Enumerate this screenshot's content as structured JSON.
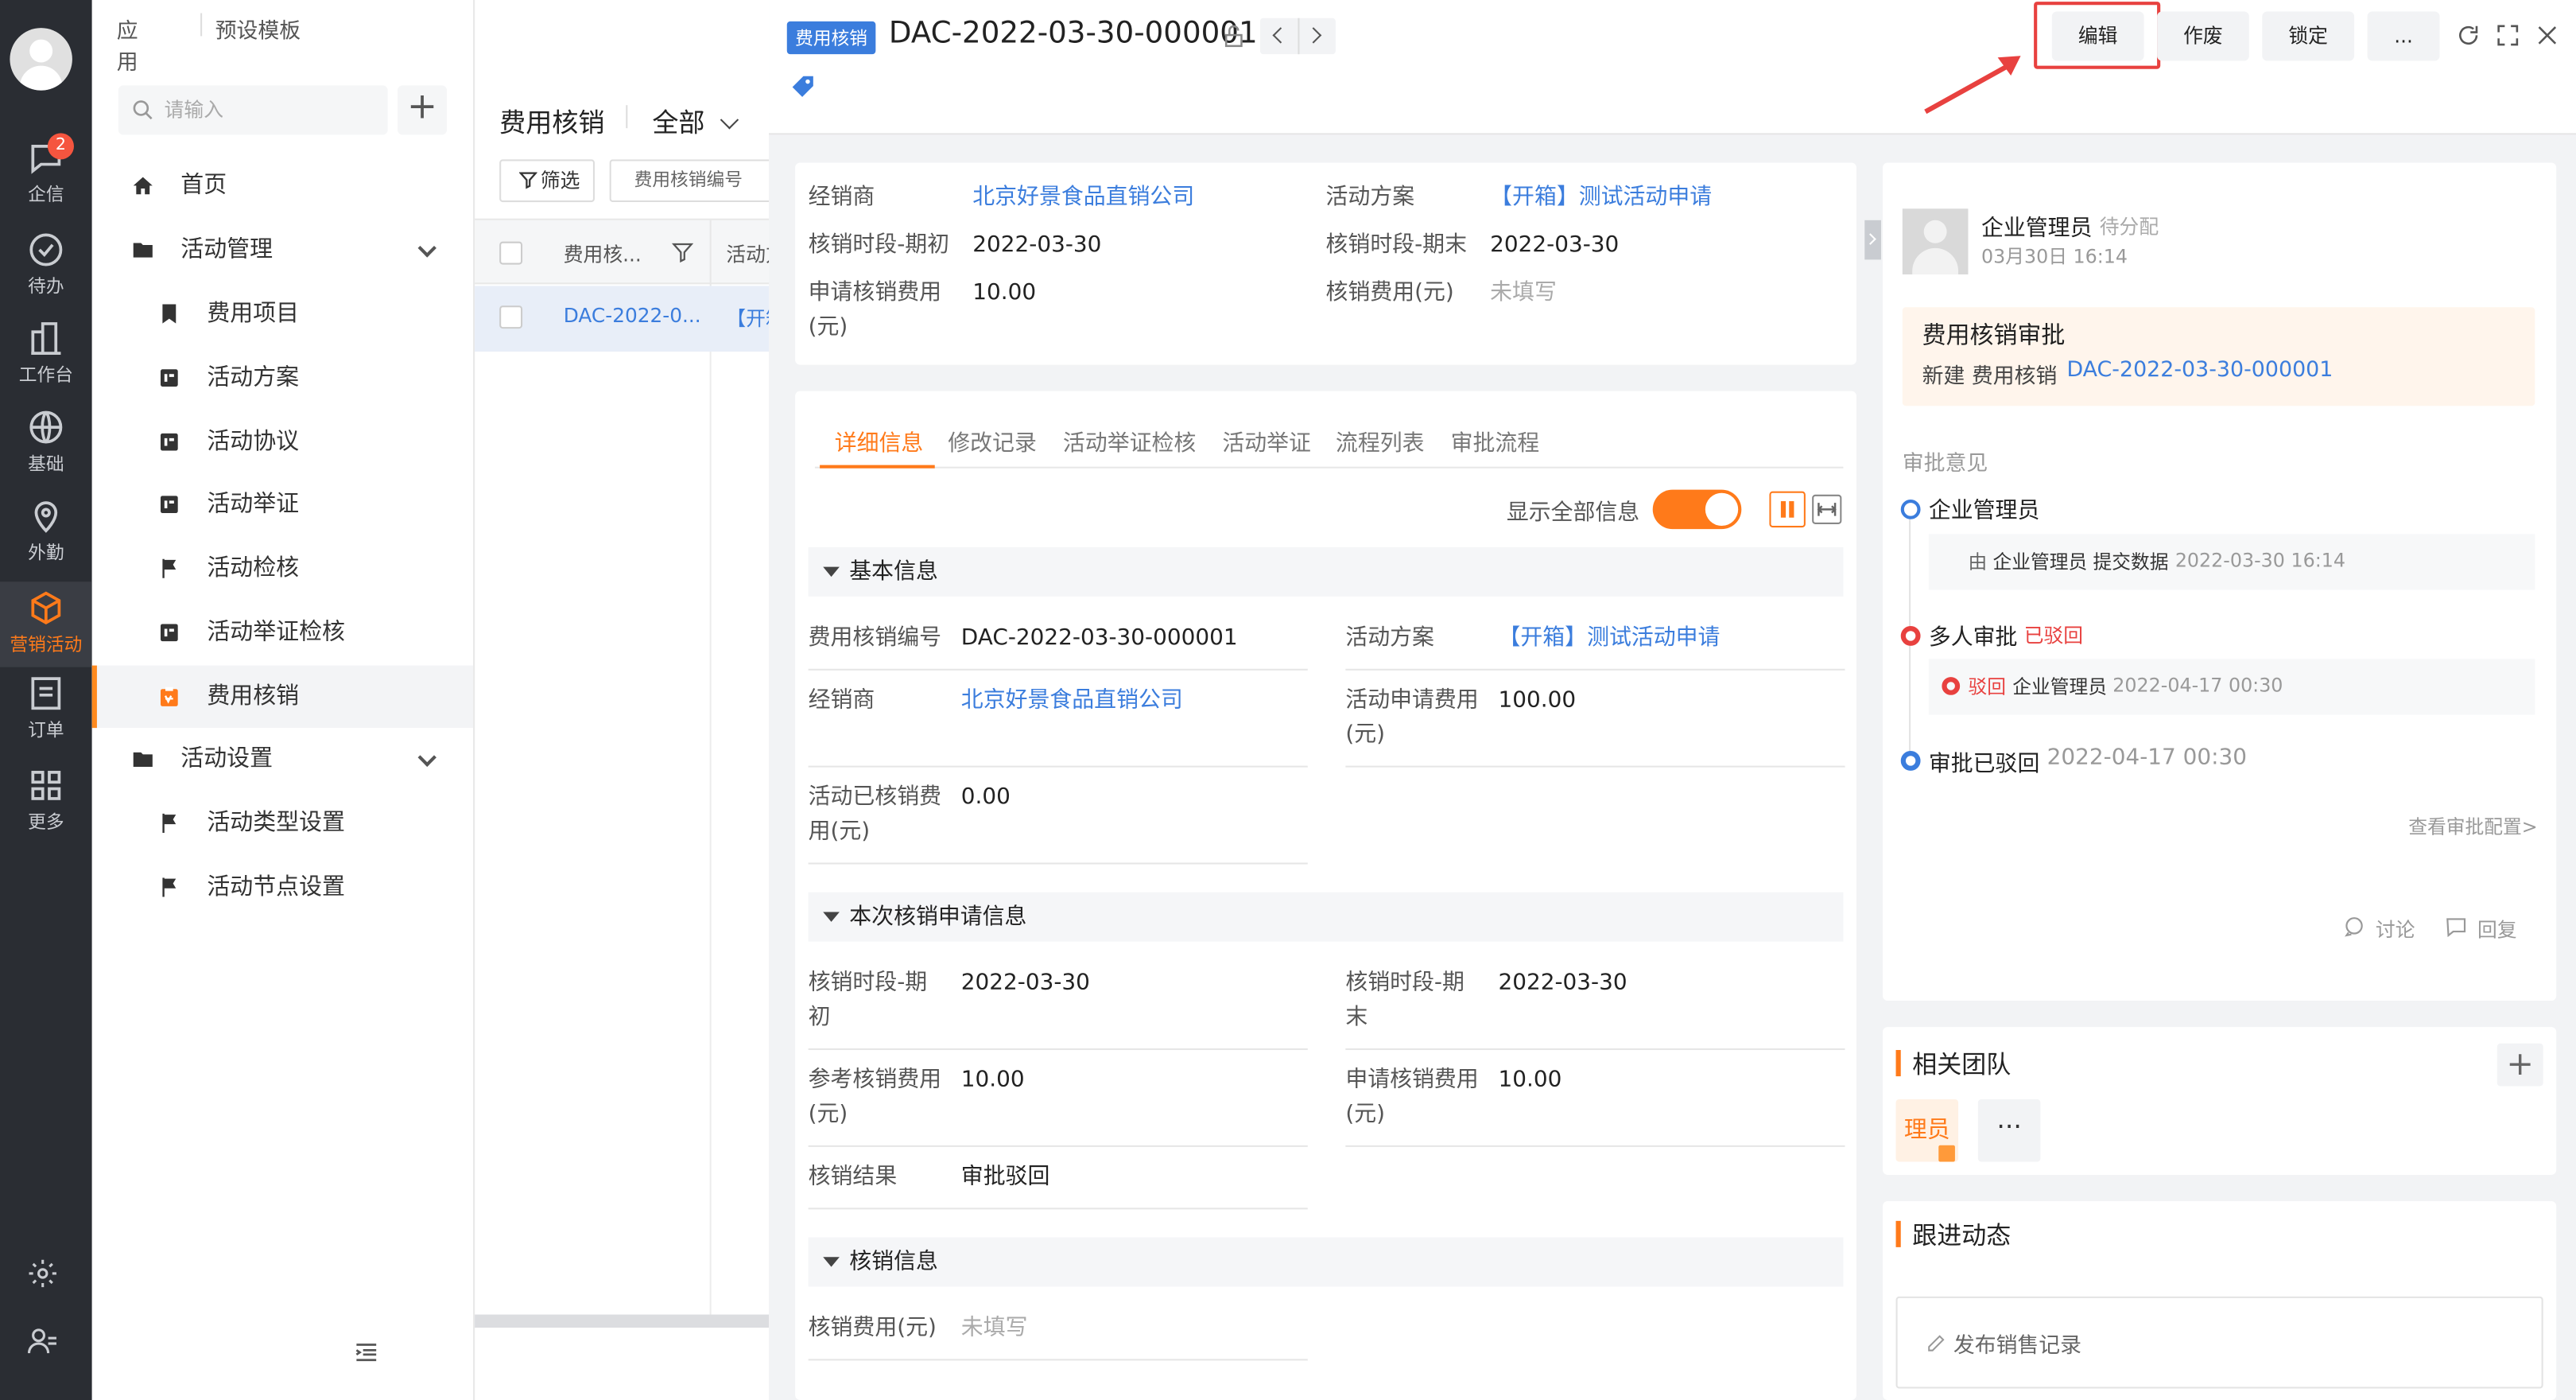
{
  "rail": {
    "badge": "2",
    "items": [
      {
        "label": "企信"
      },
      {
        "label": "待办"
      },
      {
        "label": "工作台"
      },
      {
        "label": "基础"
      },
      {
        "label": "外勤"
      },
      {
        "label": "营销活动"
      },
      {
        "label": "订单"
      },
      {
        "label": "更多"
      }
    ]
  },
  "topnav": {
    "apps": "应用",
    "templates": "预设模板"
  },
  "search": {
    "placeholder": "请输入"
  },
  "nav": {
    "home": "首页",
    "activity_mgmt": "活动管理",
    "expense_item": "费用项目",
    "activity_plan": "活动方案",
    "activity_agreement": "活动协议",
    "activity_proof": "活动举证",
    "activity_check": "活动检核",
    "proof_check": "活动举证检核",
    "expense_writeoff": "费用核销",
    "activity_settings": "活动设置",
    "type_settings": "活动类型设置",
    "node_settings": "活动节点设置"
  },
  "list": {
    "title": "费用核销",
    "scope": "全部",
    "filter": "筛选",
    "field_select": "费用核销编号",
    "col1": "费用核...",
    "col2": "活动方",
    "row_code": "DAC-2022-0...",
    "row_plan": "【开箱"
  },
  "header": {
    "tag": "费用核销",
    "record_id": "DAC-2022-03-30-000001",
    "edit": "编辑",
    "void": "作废",
    "lock": "锁定",
    "more": "..."
  },
  "summary": {
    "dealer_label": "经销商",
    "dealer": "北京好景食品直销公司",
    "plan_label": "活动方案",
    "plan": "【开箱】测试活动申请",
    "period_start_label": "核销时段-期初",
    "period_start": "2022-03-30",
    "period_end_label": "核销时段-期末",
    "period_end": "2022-03-30",
    "apply_fee_label_1": "申请核销费用",
    "apply_fee_label_2": "(元)",
    "apply_fee": "10.00",
    "fee_label": "核销费用(元)",
    "fee": "未填写"
  },
  "tabs": [
    "详细信息",
    "修改记录",
    "活动举证检核",
    "活动举证",
    "流程列表",
    "审批流程"
  ],
  "toggle": {
    "label": "显示全部信息"
  },
  "basic": {
    "title": "基本信息",
    "code_label": "费用核销编号",
    "code": "DAC-2022-03-30-000001",
    "plan_label": "活动方案",
    "plan": "【开箱】测试活动申请",
    "dealer_label": "经销商",
    "dealer": "北京好景食品直销公司",
    "apply_fee_label_1": "活动申请费用",
    "apply_fee_label_2": "(元)",
    "apply_fee": "100.00",
    "used_label_1": "活动已核销费",
    "used_label_2": "用(元)",
    "used": "0.00"
  },
  "apply": {
    "title": "本次核销申请信息",
    "start_label_1": "核销时段-期",
    "start_label_2": "初",
    "start": "2022-03-30",
    "end_label_1": "核销时段-期",
    "end_label_2": "末",
    "end": "2022-03-30",
    "ref_label_1": "参考核销费用",
    "ref_label_2": "(元)",
    "ref": "10.00",
    "req_label_1": "申请核销费用",
    "req_label_2": "(元)",
    "req": "10.00",
    "result_label": "核销结果",
    "result": "审批驳回"
  },
  "writeoff": {
    "title": "核销信息",
    "fee_label": "核销费用(元)",
    "fee": "未填写"
  },
  "approval": {
    "user": "企业管理员",
    "status": "待分配",
    "time": "03月30日 16:14",
    "title": "费用核销审批",
    "sub_prefix": "新建 费用核销",
    "sub_link": "DAC-2022-03-30-000001",
    "opinion": "审批意见",
    "n1": "企业管理员",
    "n1_detail_pre": "由",
    "n1_detail_user": "企业管理员",
    "n1_detail_act": "提交数据",
    "n1_detail_time": "2022-03-30 16:14",
    "n2": "多人审批",
    "n2_status": "已驳回",
    "n2_detail_status": "驳回",
    "n2_detail_user": "企业管理员",
    "n2_detail_time": "2022-04-17 00:30",
    "n3": "审批已驳回",
    "n3_time": "2022-04-17 00:30",
    "config_link": "查看审批配置>",
    "discuss": "讨论",
    "reply": "回复"
  },
  "team": {
    "title": "相关团队",
    "member": "理员"
  },
  "follow": {
    "title": "跟进动态",
    "placeholder": "发布销售记录"
  },
  "colors": {
    "accent": "#ff7a1a",
    "link": "#3b7ddd",
    "rail": "#2a2d33",
    "danger": "#e8413f"
  }
}
